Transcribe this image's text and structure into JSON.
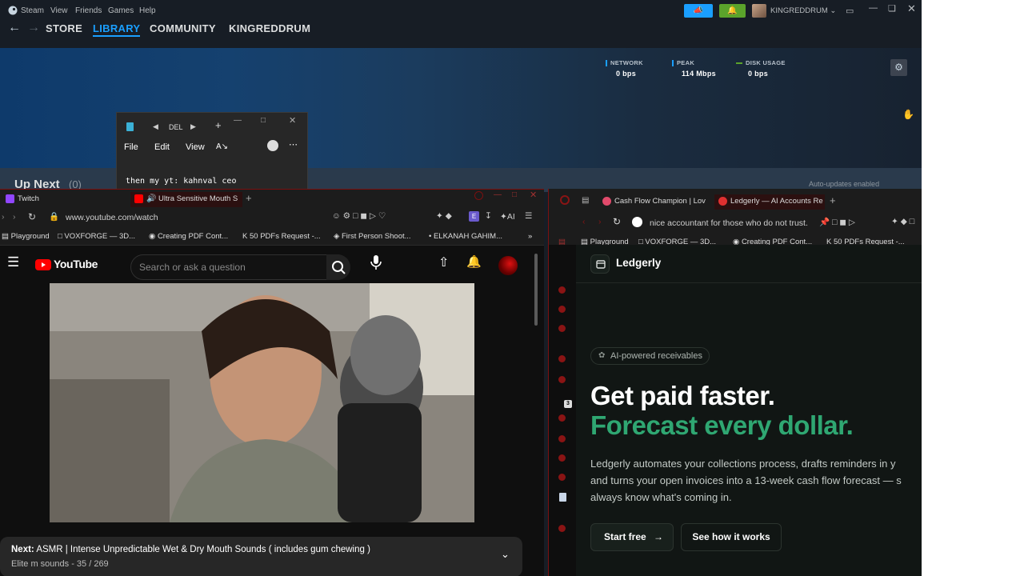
{
  "steam": {
    "app_name": "Steam",
    "menu": [
      "View",
      "Friends",
      "Games",
      "Help"
    ],
    "nav": [
      "STORE",
      "LIBRARY",
      "COMMUNITY",
      "KINGREDDRUM"
    ],
    "username": "KINGREDDRUM",
    "stats": [
      {
        "label": "NETWORK",
        "value": "0 bps",
        "color": "#1a9fff"
      },
      {
        "label": "PEAK",
        "value": "114 Mbps",
        "color": "#1a9fff"
      },
      {
        "label": "DISK USAGE",
        "value": "0 bps",
        "color": "#5ba32b"
      }
    ],
    "up_next": "Up Next",
    "up_next_count": "(0)",
    "auto_updates": "Auto-updates enabled"
  },
  "notepad": {
    "tab_title": "DEL",
    "menu": [
      "File",
      "Edit",
      "View"
    ],
    "text": "then my yt: kahnval ceo"
  },
  "browser_left": {
    "tabs": [
      "Twitch",
      "Ultra Sensitive Mouth S"
    ],
    "url": "www.youtube.com/watch",
    "ai_label": "AI",
    "bookmarks": [
      "Playground",
      "VOXFORGE — 3D...",
      "Creating PDF Cont...",
      "50 PDFs Request -...",
      "First Person Shoot...",
      "ELKANAH GAHIM..."
    ],
    "youtube": {
      "logo": "YouTube",
      "search_placeholder": "Search or ask a question"
    },
    "next": {
      "prefix": "Next:",
      "title": "ASMR | Intense Unpredictable Wet & Dry Mouth Sounds ( includes gum chewing )",
      "playlist": "Elite m sounds - 35 / 269"
    }
  },
  "browser_right": {
    "tabs": [
      "Cash Flow Champion | Lov",
      "Ledgerly — AI Accounts Re"
    ],
    "url": "nice accountant for those who do not trust.",
    "bookmarks": [
      "Playground",
      "VOXFORGE — 3D...",
      "Creating PDF Cont...",
      "50 PDFs Request -..."
    ],
    "sidebar_badge": "3",
    "ledgerly": {
      "brand": "Ledgerly",
      "chip": "AI-powered receivables",
      "headline_1": "Get paid faster.",
      "headline_2": "Forecast every dollar.",
      "paragraph_1": "Ledgerly automates your collections process, drafts reminders in y",
      "paragraph_2": "and turns your open invoices into a 13-week cash flow forecast — s",
      "paragraph_3": "always know what's coming in.",
      "cta_primary": "Start free",
      "cta_secondary": "See how it works",
      "accent": "#2fa772"
    }
  }
}
